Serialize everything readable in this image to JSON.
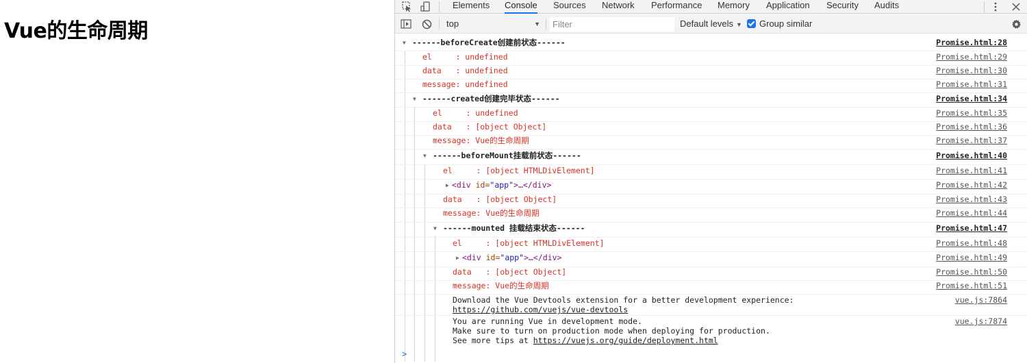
{
  "page": {
    "title": "Vue的生命周期"
  },
  "devtools": {
    "tabs": [
      "Elements",
      "Console",
      "Sources",
      "Network",
      "Performance",
      "Memory",
      "Application",
      "Security",
      "Audits"
    ],
    "selected_tab": "Console",
    "toolbar": {
      "context": "top",
      "filter_placeholder": "Filter",
      "levels": "Default levels",
      "group_similar": "Group similar",
      "group_similar_checked": true
    },
    "colors": {
      "accent": "#1a73e8",
      "error_text": "#d93025"
    },
    "icons": [
      "inspect-icon",
      "device-icon",
      "more-icon",
      "close-icon",
      "sidebar-toggle-icon",
      "clear-icon",
      "settings-icon"
    ]
  },
  "console": {
    "messages": [
      {
        "text": "------beforeCreate创建前状态------",
        "src": "Promise.html:28"
      },
      {
        "text": "el     : undefined",
        "src": "Promise.html:29"
      },
      {
        "text": "data   : undefined",
        "src": "Promise.html:30"
      },
      {
        "text": "message: undefined",
        "src": "Promise.html:31"
      },
      {
        "text": "------created创建完毕状态------",
        "src": "Promise.html:34"
      },
      {
        "text": "el     : undefined",
        "src": "Promise.html:35"
      },
      {
        "text": "data   : [object Object]",
        "src": "Promise.html:36"
      },
      {
        "text": "message: Vue的生命周期",
        "src": "Promise.html:37"
      },
      {
        "text": "------beforeMount挂载前状态------",
        "src": "Promise.html:40"
      },
      {
        "text": "el     : [object HTMLDivElement]",
        "src": "Promise.html:41"
      },
      {
        "tag": "<div",
        "attr": " id=",
        "val": "\"app\"",
        "rest": ">…</div>",
        "src": "Promise.html:42"
      },
      {
        "text": "data   : [object Object]",
        "src": "Promise.html:43"
      },
      {
        "text": "message: Vue的生命周期",
        "src": "Promise.html:44"
      },
      {
        "text": "------mounted 挂载结束状态------",
        "src": "Promise.html:47"
      },
      {
        "text": "el     : [object HTMLDivElement]",
        "src": "Promise.html:48"
      },
      {
        "tag": "<div",
        "attr": " id=",
        "val": "\"app\"",
        "rest": ">…</div>",
        "src": "Promise.html:49"
      },
      {
        "text": "data   : [object Object]",
        "src": "Promise.html:50"
      },
      {
        "text": "message: Vue的生命周期",
        "src": "Promise.html:51"
      },
      {
        "line1": "Download the Vue Devtools extension for a better development experience:",
        "link": "https://github.com/vuejs/vue-devtools",
        "src": "vue.js:7864"
      },
      {
        "line1": "You are running Vue in development mode.",
        "line2": "Make sure to turn on production mode when deploying for production.",
        "line3_prefix": "See more tips at ",
        "link": "https://vuejs.org/guide/deployment.html",
        "src": "vue.js:7874"
      }
    ],
    "prompt": ">"
  }
}
